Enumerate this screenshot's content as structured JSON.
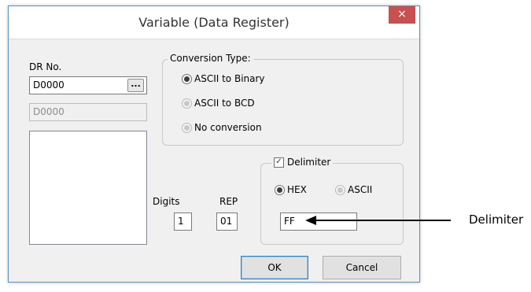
{
  "window": {
    "title": "Variable (Data Register)",
    "close_label": "×"
  },
  "dr": {
    "label": "DR No.",
    "value": "D0000",
    "browse_label": "...",
    "readonly_value": "D0000"
  },
  "conversion": {
    "title": "Conversion Type:",
    "options": [
      "ASCII to Binary",
      "ASCII to BCD",
      "No conversion"
    ],
    "selected": "ASCII to Binary"
  },
  "digits": {
    "label": "Digits",
    "value": "1"
  },
  "rep": {
    "label": "REP",
    "value": "01"
  },
  "delimiter": {
    "checkbox_label": "Delimiter",
    "checked": true,
    "hex_label": "HEX",
    "ascii_label": "ASCII",
    "selected": "HEX",
    "value": "FF"
  },
  "buttons": {
    "ok": "OK",
    "cancel": "Cancel"
  },
  "annotation": {
    "label": "Delimiter"
  },
  "colors": {
    "close_button": "#c75050",
    "window_border": "#5b8fc7",
    "dialog_bg": "#f0f0f0"
  },
  "icons": {
    "close": "close-icon",
    "checkmark": "check-icon"
  }
}
